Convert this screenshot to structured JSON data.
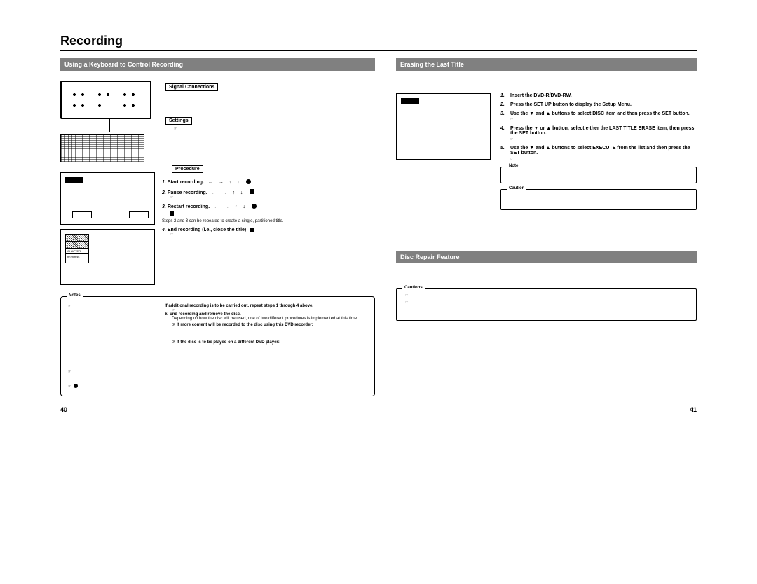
{
  "pageTitle": "Recording",
  "pageNumLeft": "40",
  "pageNumRight": "41",
  "left": {
    "sectionTitle": "Using a Keyboard to Control Recording",
    "signalConnections": "Signal Connections",
    "settings": "Settings",
    "refSmall": "☞",
    "procedure": "Procedure",
    "steps": {
      "s1": "Start recording.",
      "s2": "Pause recording.",
      "s3": "Restart recording.",
      "note23": "Steps 2 and 3 can be repeated to create a single, partitioned title.",
      "s4": "End recording (i.e., close the title)",
      "preAdditional": "If additional recording is to be carried out, repeat steps 1 through 4 above.",
      "s5": "End recording and remove the disc.",
      "s5sub": "Depending on how the disc will be used, one of two different procedures is implemented at this time.",
      "s5a": "If more content will be recorded to the disc using this DVD recorder:",
      "s5b": "If the disc is to be played on a different DVD player:"
    },
    "notesLabel": "Notes",
    "arrowSeq": "← → ↑ ↓"
  },
  "rightTop": {
    "sectionTitle": "Erasing the Last Title",
    "s1": "Insert the DVD-R/DVD-RW.",
    "s2": "Press the SET UP button to display the Setup Menu.",
    "s3": "Use the ▼ and ▲ buttons to select DISC item and then press the SET button.",
    "s4": "Press the ▼ or ▲ button, select either the LAST TITLE ERASE item, then press the SET button.",
    "s5": "Use the ▼ and ▲ buttons to select EXECUTE from the list and then press the SET button.",
    "noteLabel": "Note",
    "cautionLabel": "Caution"
  },
  "rightBottom": {
    "sectionTitle": "Disc Repair Feature",
    "cautionsLabel": "Cautions"
  }
}
